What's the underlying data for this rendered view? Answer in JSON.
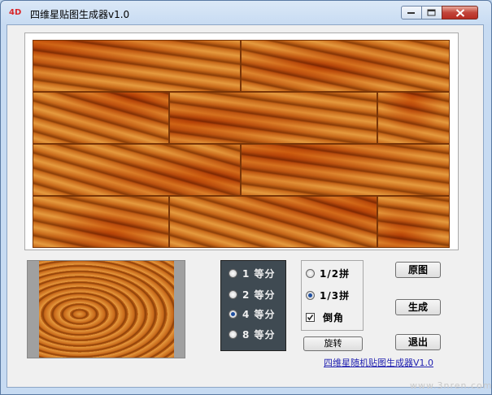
{
  "window": {
    "title": "四维星贴图生成器v1.0",
    "app_icon_text": "4D",
    "icons": [
      "minimize-icon",
      "maximize-icon",
      "close-icon"
    ]
  },
  "preview": {
    "texture": "wood-planks",
    "colors": {
      "base": "#c8691a",
      "dark": "#8a3e08",
      "light": "#e59a3e"
    }
  },
  "divisions": {
    "options": [
      "1 等分",
      "2 等分",
      "4 等分",
      "8 等分"
    ],
    "selected": "4 等分"
  },
  "pattern": {
    "half_label": "1/2拼",
    "third_label": "1/3拼",
    "selected": "1/3拼",
    "bevel_label": "倒角",
    "bevel_checked": true
  },
  "buttons": {
    "rotate": "旋转",
    "original": "原图",
    "generate": "生成",
    "exit": "退出"
  },
  "footer": {
    "link_text": "四维星随机贴图生成器V1.0",
    "watermark": "www.3nren.com"
  }
}
